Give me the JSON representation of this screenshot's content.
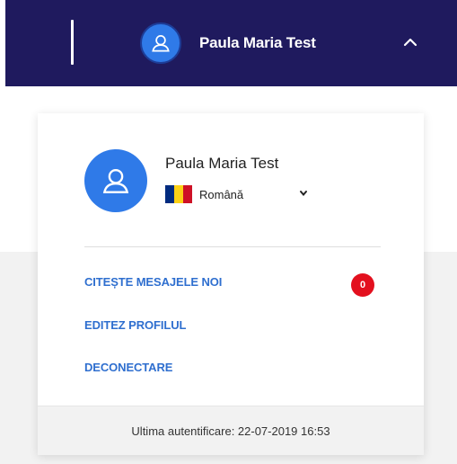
{
  "header": {
    "user_name": "Paula Maria Test",
    "background_color": "#1f1a5e",
    "toggle_icon": "chevron-up-icon"
  },
  "profile": {
    "name": "Paula Maria Test",
    "avatar_icon": "user-icon",
    "avatar_color": "#2f7ae8",
    "language": {
      "label": "Română",
      "flag": "romania-flag-icon",
      "flag_colors": [
        "#002B7F",
        "#FCD116",
        "#CE1126"
      ]
    }
  },
  "menu": {
    "items": [
      {
        "label": "CITEȘTE MESAJELE NOI",
        "badge": "0"
      },
      {
        "label": "EDITEZ PROFILUL"
      },
      {
        "label": "DECONECTARE"
      }
    ],
    "link_color": "#2f6fcf",
    "badge_color": "#e3101e"
  },
  "footer": {
    "last_login": "Ultima autentificare: 22-07-2019 16:53"
  }
}
